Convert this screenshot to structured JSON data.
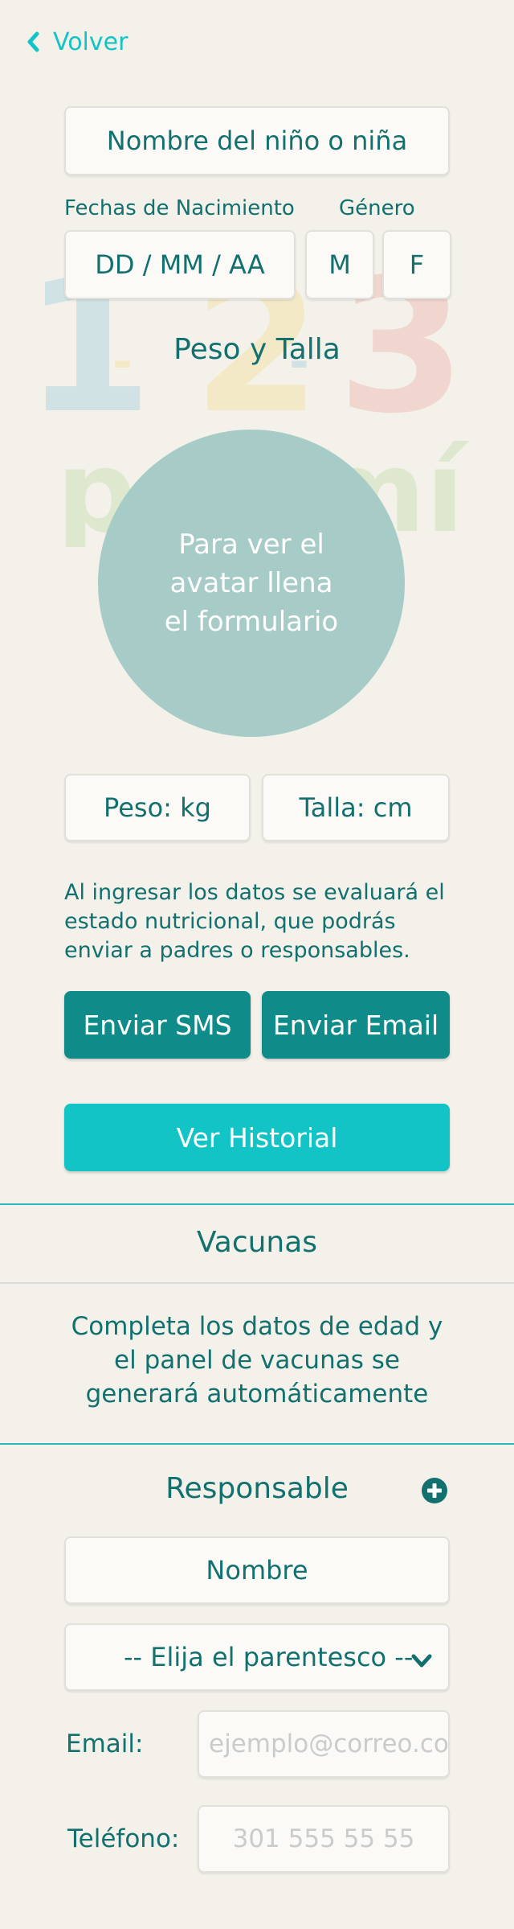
{
  "nav": {
    "back_label": "Volver"
  },
  "form": {
    "child_name_placeholder": "Nombre del niño o niña",
    "birth_date_label": "Fechas de Nacimiento",
    "birth_date_placeholder": "DD / MM / AA",
    "gender_label": "Género",
    "gender_options": [
      "M",
      "F"
    ],
    "weight_height_title": "Peso y Talla",
    "avatar_text": "Para ver el avatar llena el formulario",
    "weight_placeholder": "Peso: kg",
    "height_placeholder": "Talla: cm",
    "info_text": "Al ingresar los datos se evaluará el estado nutricional, que podrás enviar a padres o responsables."
  },
  "actions": {
    "sms_label": "Enviar SMS",
    "email_label": "Enviar Email",
    "history_label": "Ver Historial"
  },
  "vaccines": {
    "title": "Vacunas",
    "message": "Completa los datos de edad y el panel de vacunas se generará automáticamente"
  },
  "responsible": {
    "title": "Responsable",
    "name_placeholder": "Nombre",
    "relation_selected": "-- Elija el parentesco --",
    "email_label": "Email:",
    "email_placeholder": "ejemplo@correo.co",
    "phone_label": "Teléfono:",
    "phone_placeholder": "301 555 55 55"
  },
  "colors": {
    "background": "#f3f1ea",
    "text": "#12706f",
    "button_dark": "#0f8c8a",
    "button_light": "#12c4c6",
    "avatar_circle": "#a7cbc6",
    "divider": "#2bb8c0"
  },
  "icons": {
    "back": "chevron-left-icon",
    "add": "plus-circle-icon",
    "dropdown": "chevron-down-icon"
  },
  "watermark_logo": "1 2 3 por mí"
}
